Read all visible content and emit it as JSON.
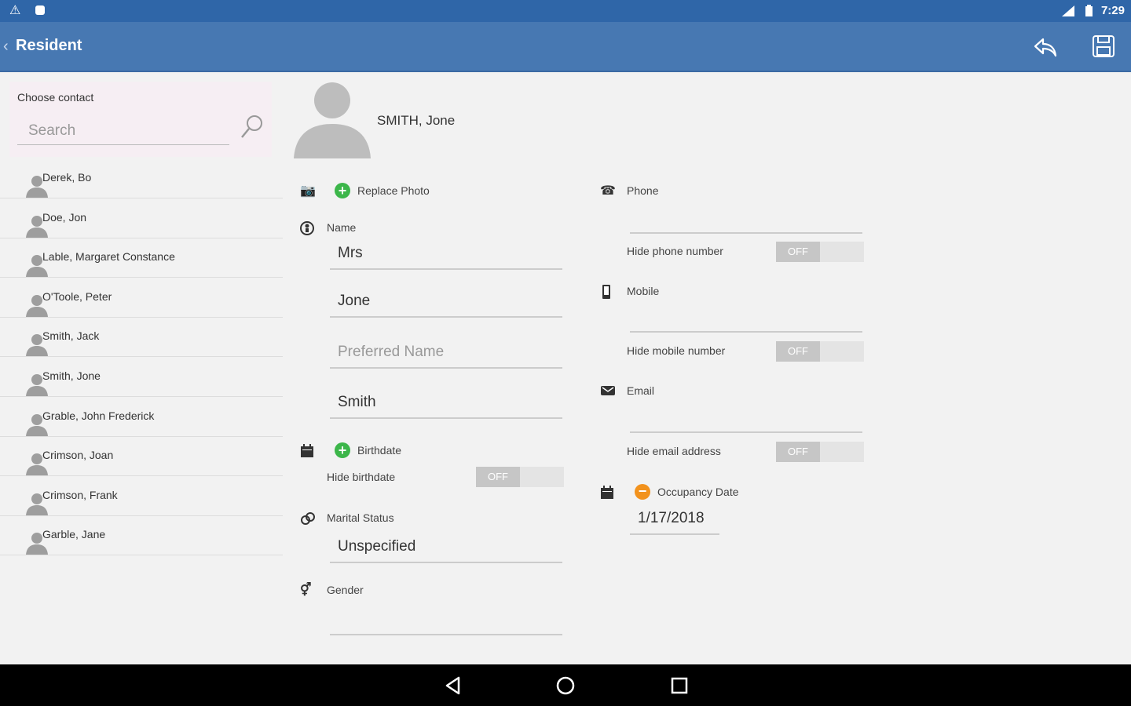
{
  "status_bar": {
    "time": "7:29",
    "icons": [
      "warning-icon",
      "notification-dot-icon",
      "signal-icon",
      "battery-icon"
    ]
  },
  "app_bar": {
    "back_glyph": "‹",
    "title": "Resident",
    "actions": [
      "reply-icon",
      "save-icon"
    ]
  },
  "sidebar": {
    "search_label": "Choose contact",
    "search_placeholder": "Search",
    "contacts": [
      "Derek, Bo",
      "Doe, Jon",
      "Lable, Margaret Constance",
      "O'Toole, Peter",
      "Smith, Jack",
      "Smith, Jone",
      "Grable, John Frederick",
      "Crimson, Joan",
      "Crimson, Frank",
      "Garble, Jane"
    ]
  },
  "profile": {
    "display_name": "SMITH, Jone",
    "replace_photo_label": "Replace Photo",
    "name_label": "Name",
    "title_value": "Mrs",
    "first_name_value": "Jone",
    "preferred_name_placeholder": "Preferred Name",
    "last_name_value": "Smith",
    "birthdate_label": "Birthdate",
    "hide_birthdate_label": "Hide birthdate",
    "marital_status_label": "Marital Status",
    "marital_status_value": "Unspecified",
    "gender_label": "Gender",
    "gender_value": ""
  },
  "contact_info": {
    "phone_label": "Phone",
    "phone_value": "",
    "hide_phone_label": "Hide phone number",
    "mobile_label": "Mobile",
    "mobile_value": "",
    "hide_mobile_label": "Hide mobile number",
    "email_label": "Email",
    "email_value": "",
    "hide_email_label": "Hide email address",
    "occupancy_label": "Occupancy Date",
    "occupancy_value": "1/17/2018"
  },
  "toggles": {
    "off_label": "OFF"
  },
  "colors": {
    "status_bar": "#2f66a8",
    "app_bar": "#4778b2",
    "add_green": "#3cb64a",
    "remove_orange": "#f2921d"
  }
}
